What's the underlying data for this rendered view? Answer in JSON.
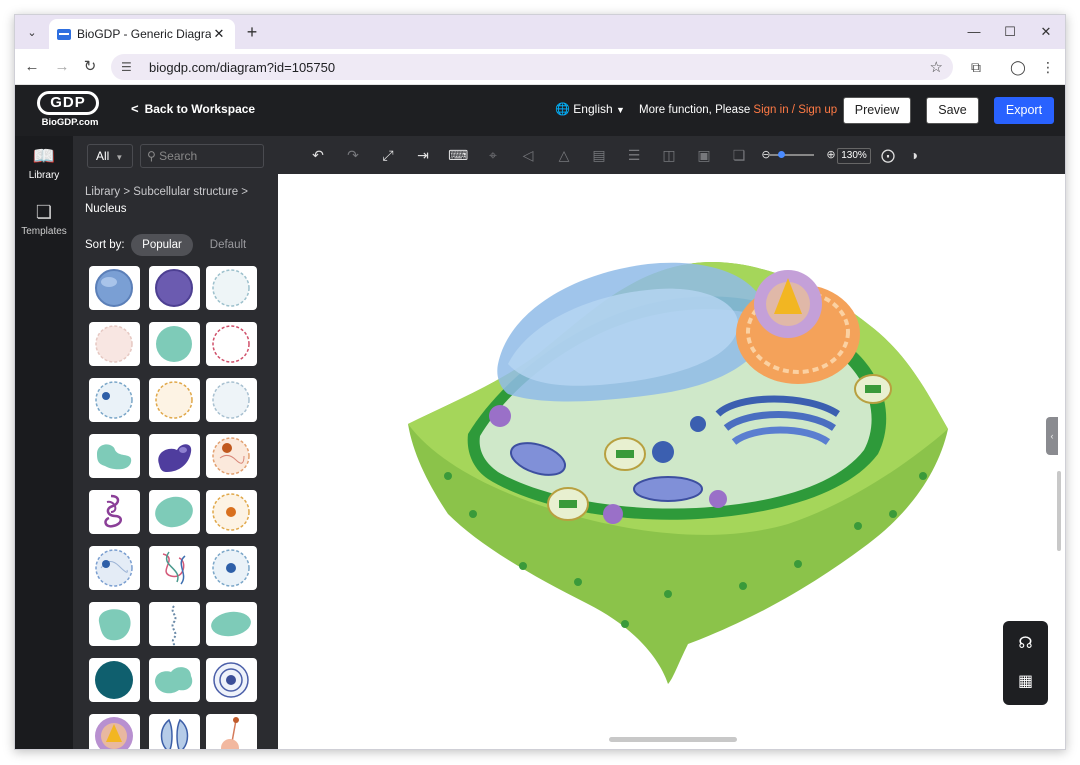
{
  "browser": {
    "tab_title": "BioGDP - Generic Diagrammi",
    "url": "biogdp.com/diagram?id=105750"
  },
  "header": {
    "logo_text": "GDP",
    "logo_domain": "BioGDP.com",
    "back_label": "Back to Workspace",
    "language": "English",
    "more_prefix": "More function, Please ",
    "sign_in": "Sign in",
    "separator": " / ",
    "sign_up": "Sign up",
    "preview_label": "Preview",
    "save_label": "Save",
    "export_label": "Export"
  },
  "rail": {
    "library_label": "Library",
    "templates_label": "Templates"
  },
  "panel": {
    "filter_value": "All",
    "search_placeholder": "Search",
    "breadcrumb_root": "Library",
    "breadcrumb_mid": "Subcellular structure",
    "breadcrumb_current": "Nucleus",
    "sort_label": "Sort by:",
    "sort_popular": "Popular",
    "sort_default": "Default"
  },
  "toolbar": {
    "zoom": "130%"
  },
  "colors": {
    "accent": "#2962ff",
    "link": "#ff7a45",
    "header_bg": "#1e1f22",
    "panel_bg": "#2b2c30"
  }
}
